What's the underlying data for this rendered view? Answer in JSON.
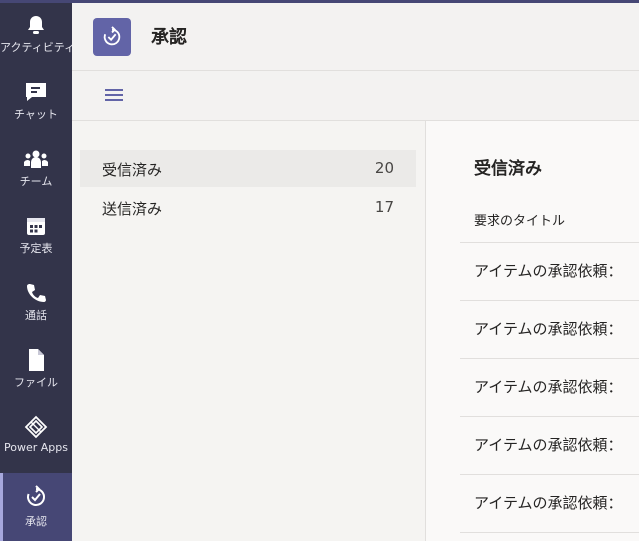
{
  "app_rail": {
    "items": [
      {
        "label": "アクティビティ",
        "icon": "bell-icon"
      },
      {
        "label": "チャット",
        "icon": "chat-icon"
      },
      {
        "label": "チーム",
        "icon": "teams-icon"
      },
      {
        "label": "予定表",
        "icon": "calendar-icon"
      },
      {
        "label": "通話",
        "icon": "phone-icon"
      },
      {
        "label": "ファイル",
        "icon": "file-icon"
      },
      {
        "label": "Power Apps",
        "icon": "power-apps-icon"
      },
      {
        "label": "承認",
        "icon": "approvals-icon",
        "active": true
      }
    ]
  },
  "header": {
    "title": "承認",
    "icon": "approvals-icon"
  },
  "toolbar": {
    "menu_icon": "hamburger-icon"
  },
  "left_nav": {
    "items": [
      {
        "label": "受信済み",
        "count": "20",
        "selected": true
      },
      {
        "label": "送信済み",
        "count": "17",
        "selected": false
      }
    ]
  },
  "main": {
    "title": "受信済み",
    "column_header": "要求のタイトル",
    "rows": [
      "アイテムの承認依頼：",
      "アイテムの承認依頼：",
      "アイテムの承認依頼：",
      "アイテムの承認依頼：",
      "アイテムの承認依頼："
    ]
  },
  "colors": {
    "rail_bg": "#33344a",
    "accent": "#6264a7",
    "active_rail": "#464775"
  }
}
